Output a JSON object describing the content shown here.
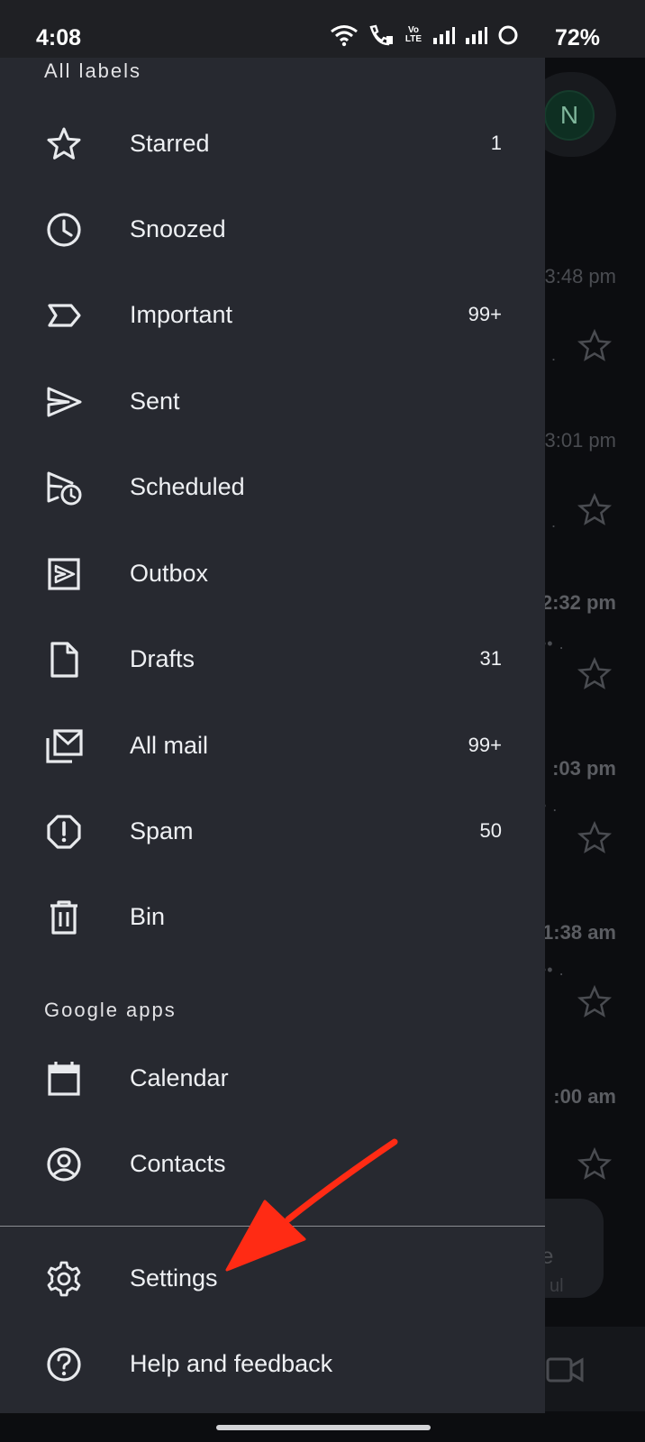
{
  "status_bar": {
    "time": "4:08",
    "battery": "72%",
    "network": "Vo LTE"
  },
  "drawer": {
    "labels_header": "All labels",
    "items": [
      {
        "label": "Starred",
        "count": "1",
        "icon": "star-icon"
      },
      {
        "label": "Snoozed",
        "count": "",
        "icon": "clock-icon"
      },
      {
        "label": "Important",
        "count": "99+",
        "icon": "important-icon"
      },
      {
        "label": "Sent",
        "count": "",
        "icon": "send-icon"
      },
      {
        "label": "Scheduled",
        "count": "",
        "icon": "scheduled-send-icon"
      },
      {
        "label": "Outbox",
        "count": "",
        "icon": "outbox-icon"
      },
      {
        "label": "Drafts",
        "count": "31",
        "icon": "draft-icon"
      },
      {
        "label": "All mail",
        "count": "99+",
        "icon": "all-mail-icon"
      },
      {
        "label": "Spam",
        "count": "50",
        "icon": "spam-icon"
      },
      {
        "label": "Bin",
        "count": "",
        "icon": "trash-icon"
      }
    ],
    "apps_header": "Google apps",
    "apps": [
      {
        "label": "Calendar",
        "icon": "calendar-icon"
      },
      {
        "label": "Contacts",
        "icon": "contacts-icon"
      }
    ],
    "footer": [
      {
        "label": "Settings",
        "icon": "gear-icon"
      },
      {
        "label": "Help and feedback",
        "icon": "help-icon"
      }
    ]
  },
  "background_inbox": {
    "avatar_letter": "N",
    "times": [
      "3:48 pm",
      "3:01 pm",
      "2:32 pm",
      ":03 pm",
      "1:38 am",
      ":00 am"
    ],
    "compose_fragment": "se",
    "sub_fragment": "ul"
  },
  "colors": {
    "drawer_bg": "#272930",
    "scrim": "#0c0d10",
    "annotation_arrow": "#ff2b14"
  }
}
